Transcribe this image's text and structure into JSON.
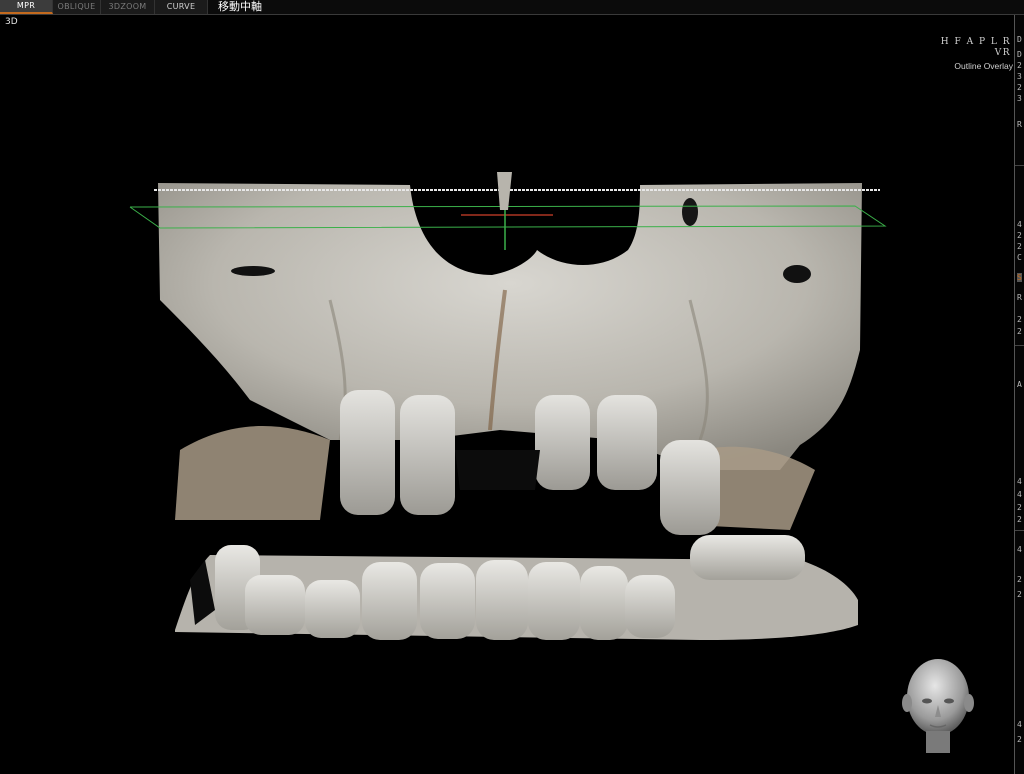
{
  "tabs": [
    {
      "label": "MPR",
      "active": true
    },
    {
      "label": "OBLIQUE",
      "active": false
    },
    {
      "label": "3DZOOM",
      "active": false
    },
    {
      "label": "CURVE",
      "active": false
    }
  ],
  "status_text": "移動中軸",
  "viewport": {
    "label": "3D",
    "orientation": "H F A P L R",
    "mode": "VR",
    "overlay": "Outline Overlay"
  },
  "side_panel_glyphs": [
    "D",
    "D",
    "2",
    "3",
    "2",
    "3",
    "R",
    "4",
    "2",
    "2",
    "C",
    "S",
    "R",
    "2",
    "2",
    "A",
    "4",
    "4",
    "2",
    "2",
    "4",
    "2",
    "2",
    "4",
    "2"
  ],
  "icons": {
    "orientation_cube": "head-orientation-icon"
  },
  "colors": {
    "accent": "#c46a1e",
    "bone": "#c8c6c0",
    "plane_line": "#3bb04a",
    "axis_line": "#d0402a"
  }
}
